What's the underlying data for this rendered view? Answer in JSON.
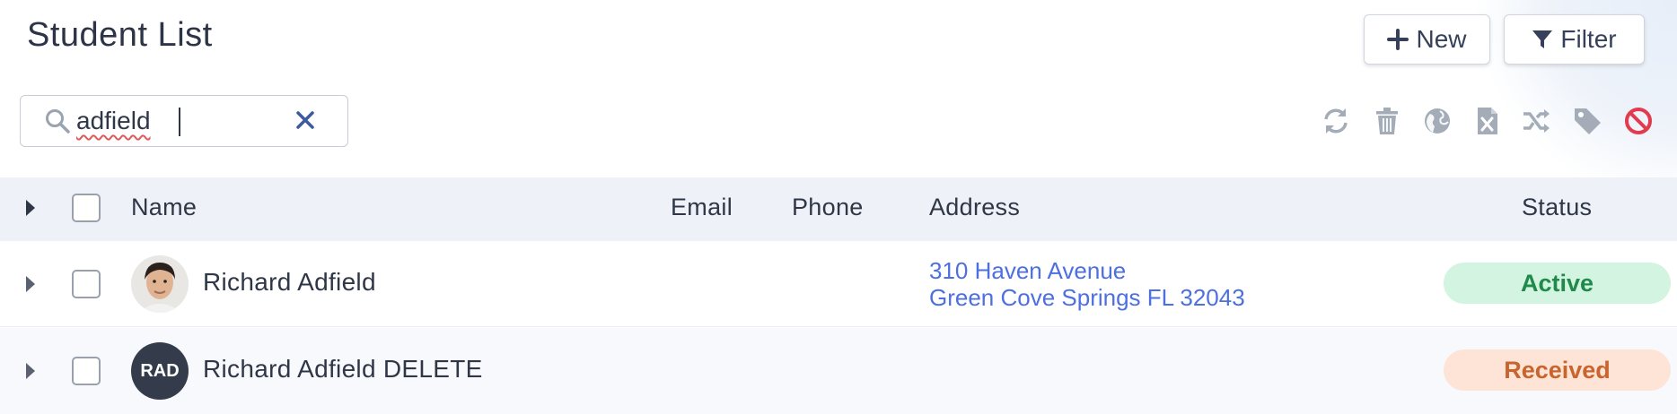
{
  "page": {
    "title": "Student List"
  },
  "header": {
    "new_label": "New",
    "filter_label": "Filter"
  },
  "search": {
    "value": "adfield"
  },
  "toolbar": {
    "icons": [
      "refresh-icon",
      "trash-icon",
      "globe-icon",
      "excel-icon",
      "shuffle-icon",
      "tag-icon",
      "block-icon"
    ]
  },
  "table": {
    "columns": {
      "name": "Name",
      "email": "Email",
      "phone": "Phone",
      "address": "Address",
      "status": "Status"
    },
    "rows": [
      {
        "name": "Richard Adfield",
        "email": "",
        "phone": "",
        "address_line1": "310 Haven Avenue",
        "address_line2": "Green Cove Springs FL 32043",
        "status": "Active",
        "avatar": "photo"
      },
      {
        "name": "Richard Adfield DELETE",
        "email": "",
        "phone": "",
        "address_line1": "",
        "address_line2": "",
        "status": "Received",
        "avatar_initials": "RAD"
      }
    ]
  },
  "colors": {
    "status_active_bg": "#d3f4e1",
    "status_active_text": "#1f8a4a",
    "status_received_bg": "#fde4d6",
    "status_received_text": "#c8652e",
    "link": "#4d6fe0",
    "block_icon": "#e23b4e"
  }
}
